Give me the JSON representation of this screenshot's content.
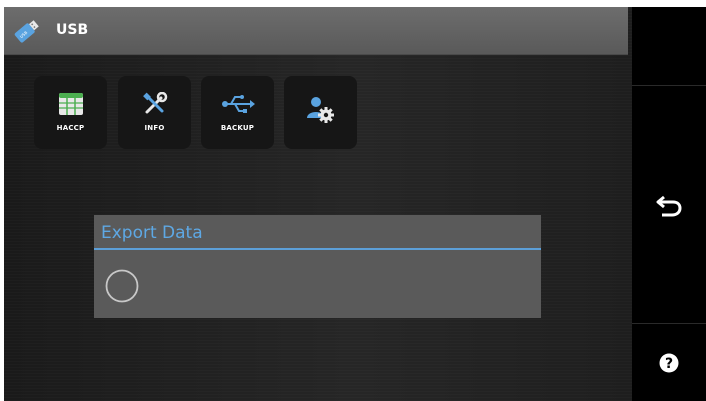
{
  "title_bar": {
    "title": "USB",
    "icon": "usb-stick-icon"
  },
  "tiles": [
    {
      "label": "HACCP",
      "icon": "haccp-table-icon"
    },
    {
      "label": "INFO",
      "icon": "tools-icon"
    },
    {
      "label": "BACKUP",
      "icon": "usb-symbol-icon"
    },
    {
      "label": "",
      "icon": "user-settings-icon"
    }
  ],
  "dialog": {
    "title": "Export Data",
    "progress_icon": "loading-spinner-icon"
  },
  "side_panel": {
    "buttons": [
      {
        "icon": "back-arrow-icon"
      },
      {
        "icon": "help-icon"
      }
    ]
  },
  "colors": {
    "accent": "#5ea8e4",
    "title_bar": "#636363",
    "dialog_bg": "#5a5a5a",
    "background": "#202020"
  }
}
